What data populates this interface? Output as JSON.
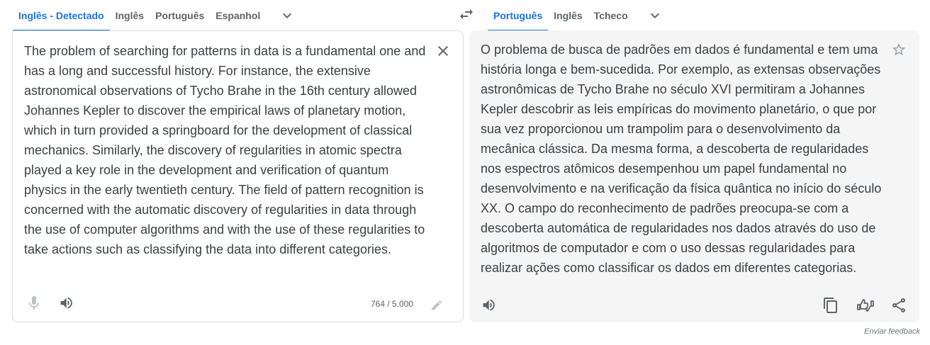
{
  "source_langs": {
    "tabs": [
      "Inglês - Detectado",
      "Inglês",
      "Português",
      "Espanhol"
    ],
    "active": 0,
    "more_icon": "chevron-down-icon"
  },
  "target_langs": {
    "tabs": [
      "Português",
      "Inglês",
      "Tcheco"
    ],
    "active": 0,
    "more_icon": "chevron-down-icon"
  },
  "swap_icon": "swap-languages-icon",
  "source": {
    "text": "The problem of searching for patterns in data is a fundamental one and has a long and successful history. For instance, the extensive astronomical observations of Tycho Brahe in the 16th century allowed Johannes Kepler to discover the empirical laws of planetary motion, which in turn provided a springboard for the development of classical mechanics. Similarly, the discovery of regularities in atomic spectra played a key role in the development and verification of quantum physics in the early twentieth century. The field of pattern recognition is concerned with the automatic discovery of regularities in data through the use of computer algorithms and with the use of these regularities to take actions such as classifying the data into different categories.",
    "char_count": "764 / 5.000",
    "icons": [
      "close-icon",
      "microphone-icon",
      "speaker-icon",
      "pencil-icon"
    ]
  },
  "target": {
    "text": "O problema de busca de padrões em dados é fundamental e tem uma história longa e bem-sucedida. Por exemplo, as extensas observações astronômicas de Tycho Brahe no século XVI permitiram a Johannes Kepler descobrir as leis empíricas do movimento planetário, o que por sua vez proporcionou um trampolim para o desenvolvimento da mecânica clássica. Da mesma forma, a descoberta de regularidades nos espectros atômicos desempenhou um papel fundamental no desenvolvimento e na verificação da física quântica no início do século XX. O campo do reconhecimento de padrões preocupa-se com a descoberta automática de regularidades nos dados através do uso de algoritmos de computador e com o uso dessas regularidades para realizar ações como classificar os dados em diferentes categorias.",
    "icons": [
      "star-icon",
      "speaker-icon",
      "copy-icon",
      "rate-translation-icon",
      "share-icon"
    ]
  },
  "feedback_label": "Enviar feedback",
  "colors": {
    "accent": "#1a73e8",
    "text": "#3c4043",
    "muted": "#5f6368",
    "target_bg": "#f5f5f5",
    "border": "#dadce0"
  }
}
